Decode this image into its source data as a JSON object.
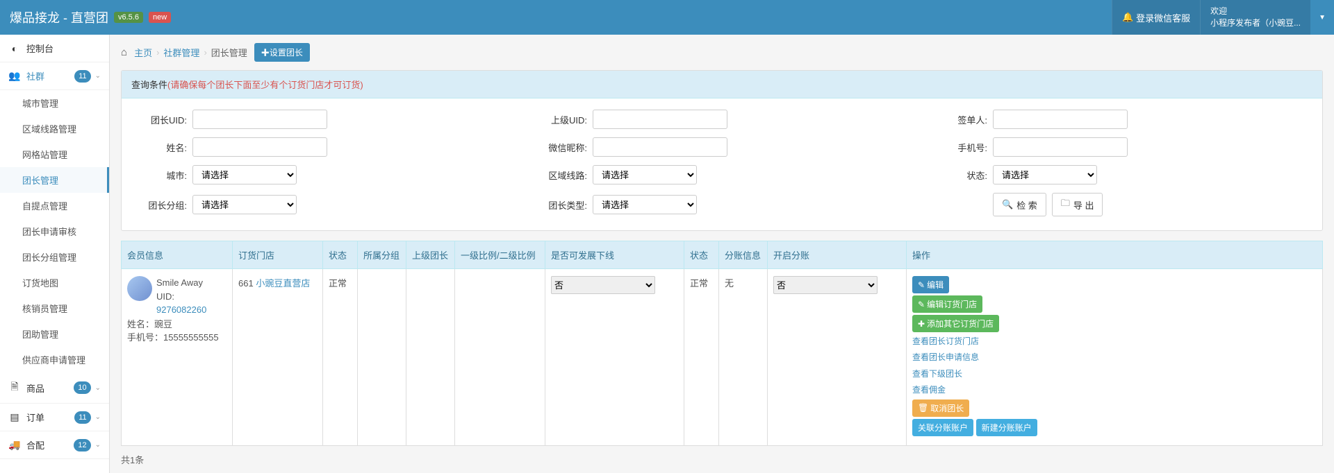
{
  "header": {
    "brand": "爆品接龙 - 直营团",
    "version": "v6.5.6",
    "new": "new",
    "wechat_btn": "登录微信客服",
    "welcome_label": "欢迎",
    "user_name": "小程序发布者（小豌豆..."
  },
  "sidebar": {
    "console": "控制台",
    "groups": {
      "label": "社群",
      "badge": "11",
      "items": [
        "城市管理",
        "区域线路管理",
        "网格站管理",
        "团长管理",
        "自提点管理",
        "团长申请审核",
        "团长分组管理",
        "订货地图",
        "核销员管理",
        "团助管理",
        "供应商申请管理"
      ]
    },
    "goods": {
      "label": "商品",
      "badge": "10"
    },
    "orders": {
      "label": "订单",
      "badge": "11"
    },
    "dist": {
      "label": "合配",
      "badge": "12"
    }
  },
  "breadcrumb": {
    "home": "主页",
    "l1": "社群管理",
    "l2": "团长管理",
    "set_btn": "设置团长"
  },
  "search": {
    "title": "查询条件",
    "warn": "(请确保每个团长下面至少有个订货门店才可订货)",
    "labels": {
      "uid": "团长UID:",
      "parent_uid": "上级UID:",
      "signer": "签单人:",
      "name": "姓名:",
      "nickname": "微信昵称:",
      "phone": "手机号:",
      "city": "城市:",
      "route": "区域线路:",
      "status": "状态:",
      "group": "团长分组:",
      "type": "团长类型:"
    },
    "placeholder_select": "请选择",
    "search_btn": "检 索",
    "export_btn": "导 出"
  },
  "table": {
    "headers": [
      "会员信息",
      "订货门店",
      "状态",
      "所属分组",
      "上级团长",
      "一级比例/二级比例",
      "是否可发展下线",
      "状态",
      "分账信息",
      "开启分账",
      "操作"
    ],
    "row": {
      "nickname": "Smile Away",
      "uid_label": "UID: ",
      "uid": "9276082260",
      "name_label": "姓名：",
      "name": "豌豆",
      "phone_label": "手机号：",
      "phone": "15555555555",
      "shop_id": "661 ",
      "shop_name": "小豌豆直营店",
      "status1": "正常",
      "dev_option": "否",
      "status2": "正常",
      "split_info": "无",
      "split_option": "否",
      "actions": {
        "edit": "编辑",
        "edit_shop": "编辑订货门店",
        "add_shop": "添加其它订货门店",
        "link1": "查看团长订货门店",
        "link2": "查看团长申请信息",
        "link3": "查看下级团长",
        "link4": "查看佣金",
        "cancel": "取消团长",
        "assoc": "关联分账账户",
        "new_split": "新建分账账户"
      }
    }
  },
  "footer": {
    "count": "共1条"
  }
}
